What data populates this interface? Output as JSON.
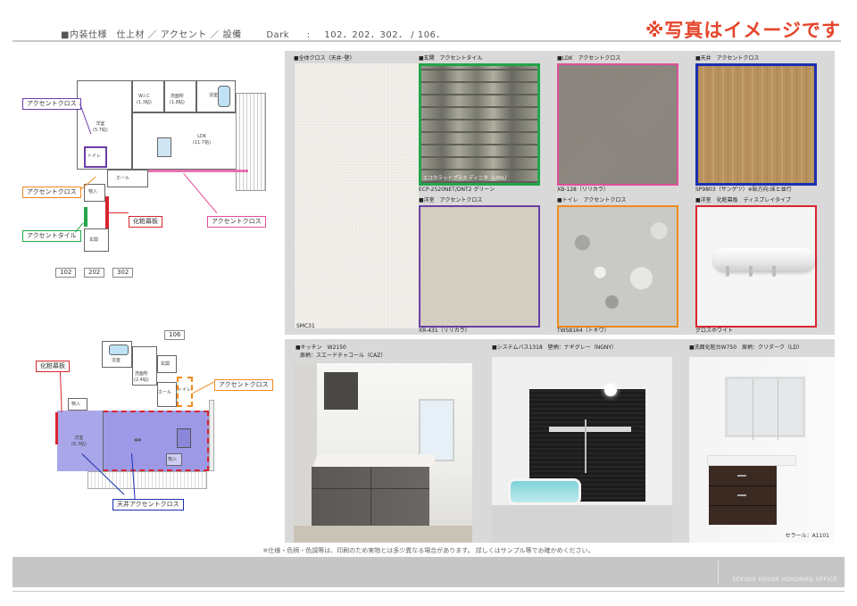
{
  "header": {
    "section": "■内装仕様　仕上材 ／ アクセント ／ 設備",
    "color_scheme": "Dark",
    "colon": ":",
    "units": "102．202．302． / 106．",
    "note": "※写真はイメージです"
  },
  "plan_a": {
    "rooms": {
      "western": "洋室",
      "western_size": "(5.7帖)",
      "wic": "W.I.C",
      "wic_size": "(1.3帖)",
      "washroom": "洗面所",
      "washroom_size": "(1.8帖)",
      "bath": "浴室",
      "ldk": "LDK",
      "ldk_size": "(11.7帖)",
      "toilet": "トイレ",
      "hall": "ホール",
      "storage": "物入",
      "entrance": "玄関"
    },
    "callouts": {
      "accent_cloth_1": "アクセントクロス",
      "accent_cloth_2": "アクセントクロス",
      "accent_tile": "アクセントタイル",
      "makeup_board": "化粧幕板",
      "accent_cloth_3": "アクセントクロス"
    },
    "units": [
      "102",
      "202",
      "302"
    ]
  },
  "plan_b": {
    "unit": "106",
    "rooms": {
      "bath": "浴室",
      "washroom": "洗面所",
      "washroom_size": "(2.4帖)",
      "entrance": "玄関",
      "hall": "ホール",
      "toilet": "トイレ",
      "storage1": "物入",
      "western": "洋室",
      "western_size": "(6.3帖)",
      "storage2": "物入",
      "arrow": "⇔"
    },
    "callouts": {
      "makeup_board": "化粧幕板",
      "accent_cloth": "アクセントクロス",
      "ceiling_accent": "天井アクセントクロス"
    }
  },
  "finishes": {
    "all_cloth": {
      "label": "■全体クロス（天井･壁）",
      "code": "SMC31"
    },
    "entrance_tile": {
      "label": "■玄関　アクセントタイル",
      "code": "ECP-2520NET/DNT2 グリーン",
      "overlay": "エコカラットプラス ディニタ（LIXIL）",
      "border": "#22a54a"
    },
    "ldk_cloth": {
      "label": "■LDK　アクセントクロス",
      "code": "XB-128（リリカラ）",
      "border": "#e0509a"
    },
    "ceiling_cloth": {
      "label": "■天井　アクセントクロス",
      "code": "SP9803（サンゲツ）※貼方向:床と並行",
      "border": "#1c2fb0"
    },
    "western_cloth": {
      "label": "■洋室　アクセントクロス",
      "code": "XR-431（リリカラ）",
      "border": "#6a3fa5"
    },
    "toilet_cloth": {
      "label": "■トイレ　アクセントクロス",
      "code": "TWS8164（トキワ）",
      "border": "#f08a1c"
    },
    "western_board": {
      "label": "■洋室　化粧幕板　ディスプレイタイプ",
      "code": "グロスホワイト",
      "border": "#d8252f"
    }
  },
  "equipment": {
    "kitchen": {
      "title": "■キッチン　W2150",
      "subtitle": "扉柄：スエードチャコール（CAZ）"
    },
    "bath": {
      "title": "■システムバス1318　壁柄：ナギグレー（NGNY）"
    },
    "vanity": {
      "title": "■洗面化粧台W750　扉柄：クリダーク（LD）",
      "note": "セラール：A1101"
    }
  },
  "footer": {
    "note": "※仕様・色柄・色調等は、印刷のため実物とは多少異なる場合があります。 詳しくはサンプル等でお確かめください。",
    "company": "SEKISUI HOUSE HOKURIKU OFFICE"
  }
}
